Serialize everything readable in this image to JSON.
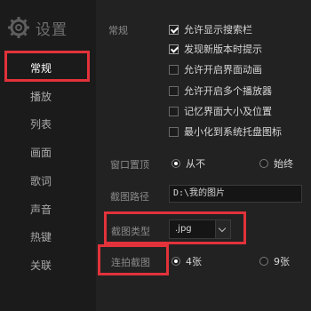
{
  "window": {
    "title": "设置"
  },
  "sidebar": {
    "items": [
      {
        "label": "常规",
        "active": true
      },
      {
        "label": "播放"
      },
      {
        "label": "列表"
      },
      {
        "label": "画面"
      },
      {
        "label": "歌词"
      },
      {
        "label": "声音"
      },
      {
        "label": "热键"
      },
      {
        "label": "关联"
      }
    ]
  },
  "general": {
    "section_label": "常规",
    "options": [
      {
        "label": "允许显示搜索栏",
        "checked": true
      },
      {
        "label": "发现新版本时提示",
        "checked": true
      },
      {
        "label": "允许开启界面动画",
        "checked": false
      },
      {
        "label": "允许开启多个播放器",
        "checked": false
      },
      {
        "label": "记忆界面大小及位置",
        "checked": false
      },
      {
        "label": "最小化到系统托盘图标",
        "checked": false
      }
    ]
  },
  "window_topmost": {
    "label": "窗口置顶",
    "options": [
      {
        "label": "从不",
        "selected": true
      },
      {
        "label": "始终",
        "selected": false
      }
    ]
  },
  "screenshot_path": {
    "label": "截图路径",
    "value": "D:\\我的图片"
  },
  "screenshot_type": {
    "label": "截图类型",
    "value": ".jpg"
  },
  "burst_shots": {
    "label": "连拍截图",
    "options": [
      {
        "label": "4张",
        "selected": true
      },
      {
        "label": "9张",
        "selected": false
      }
    ]
  },
  "colors": {
    "highlight": "#e2323a",
    "background": "#1e1e1e"
  }
}
